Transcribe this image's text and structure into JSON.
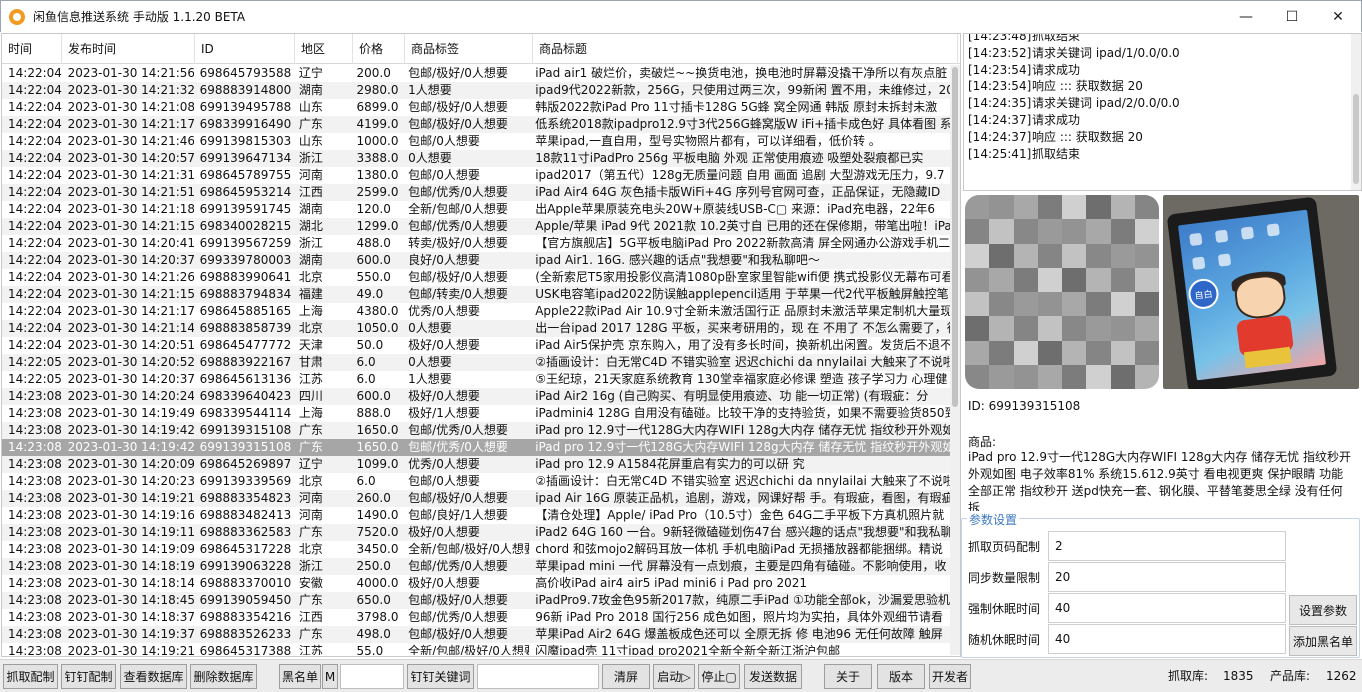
{
  "window": {
    "title": "闲鱼信息推送系统 手动版 1.1.20 BETA",
    "controls": [
      "—",
      "☐",
      "✕"
    ]
  },
  "table": {
    "headers": [
      "时间",
      "发布时间",
      "ID",
      "地区",
      "价格",
      "商品标签",
      "商品标题"
    ],
    "selected_index": 22,
    "rows": [
      [
        "14:22:04",
        "2023-01-30 14:21:56",
        "698645793588",
        "辽宁",
        "200.0",
        "包邮/极好/0人想要",
        "iPad air1 破烂价，卖破烂~~换货电池，换电池时屏幕没撬干净所以有灰点脏"
      ],
      [
        "14:22:04",
        "2023-01-30 14:21:32",
        "698883914800",
        "湖南",
        "2980.0",
        "1人想要",
        "ipad9代2022新款，256G，只使用过两三次，99新闲 置不用，未维修过，2023"
      ],
      [
        "14:22:04",
        "2023-01-30 14:21:08",
        "699139495788",
        "山东",
        "6899.0",
        "包邮/极好/0人想要",
        "韩版2022款iPad Pro 11寸插卡128G  5G蜂 窝全网通 韩版    原封未拆封未激"
      ],
      [
        "14:22:04",
        "2023-01-30 14:21:17",
        "698339916490",
        "广东",
        "4199.0",
        "包邮/极好/0人想要",
        "低系统2018款ipadpro12.9寸3代256G蜂窝版W iFi+插卡成色好 具体看图 系"
      ],
      [
        "14:22:04",
        "2023-01-30 14:21:46",
        "699139815303",
        "山东",
        "1000.0",
        "包邮/0人想要",
        "苹果ipad,一直自用，型号实物照片都有，可以详细看，低价转 。"
      ],
      [
        "14:22:04",
        "2023-01-30 14:20:57",
        "699139647134",
        "浙江",
        "3388.0",
        "0人想要",
        "18款11寸iPadPro   256g  平板电脑  外观 正常使用痕迹   吸塑处裂痕都已实"
      ],
      [
        "14:22:04",
        "2023-01-30 14:21:31",
        "698645789755",
        "河南",
        "1380.0",
        "包邮/0人想要",
        "ipad2017（第五代）128g无质量问题   自用 画面 追剧 大型游戏无压力，9.7"
      ],
      [
        "14:22:04",
        "2023-01-30 14:21:51",
        "698645953214",
        "江西",
        "2599.0",
        "包邮/优秀/0人想要",
        "iPad Air4  64G 灰色插卡版WiFi+4G 序列号官网可查，正品保证，无隐藏ID"
      ],
      [
        "14:22:04",
        "2023-01-30 14:21:18",
        "699139591745",
        "湖南",
        "120.0",
        "全新/包邮/0人想要",
        "出Apple苹果原装充电头20W+原装线USB-C▢   来源：iPad充电器，22年6"
      ],
      [
        "14:22:04",
        "2023-01-30 14:21:15",
        "698340028215",
        "湖北",
        "1299.0",
        "包邮/优秀/0人想要",
        "Apple/苹果 iPad 9代 2021款 10.2英寸自 已用的还在保修期，带笔出啦！iPa"
      ],
      [
        "14:22:04",
        "2023-01-30 14:20:41",
        "699139567259",
        "浙江",
        "488.0",
        "转卖/极好/0人想要",
        "【官方旗舰店】5G平板电脑iPad Pro 2022新款高清 屏全网通办公游戏手机二"
      ],
      [
        "14:22:04",
        "2023-01-30 14:20:37",
        "699339780003",
        "湖南",
        "600.0",
        "良好/0人想要",
        "ipad Air1. 16G. 感兴趣的话点\"我想要\"和我私聊吧～"
      ],
      [
        "14:22:04",
        "2023-01-30 14:21:26",
        "698883990641",
        "北京",
        "550.0",
        "包邮/极好/0人想要",
        "(全新索尼T5家用投影仪高清1080p卧室家里智能wifi便 携式投影仪无幕布可看"
      ],
      [
        "14:22:04",
        "2023-01-30 14:21:15",
        "698883794834",
        "福建",
        "49.0",
        "包邮/转卖/0人想要",
        "USK电容笔ipad2022防误触applepencil适用 于苹果一代2代平板触屏触控笔"
      ],
      [
        "14:22:04",
        "2023-01-30 14:21:17",
        "698645885165",
        "上海",
        "4380.0",
        "优秀/0人想要",
        "Apple22款iPad Air 10.9寸全新未激活国行正 品原封未激活苹果定制机大量现"
      ],
      [
        "14:22:04",
        "2023-01-30 14:21:14",
        "698883858739",
        "北京",
        "1050.0",
        "0人想要",
        "出一台ipad 2017 128G 平板，买来考研用的，现 在 不用了 不怎么需要了，很"
      ],
      [
        "14:22:04",
        "2023-01-30 14:20:51",
        "698645477772",
        "天津",
        "50.0",
        "极好/0人想要",
        "iPad Air5保护壳 京东购入，用了没有多长时间，换新机出闲置。发货后不退不"
      ],
      [
        "14:22:05",
        "2023-01-30 14:20:52",
        "698883922167",
        "甘肃",
        "6.0",
        "0人想要",
        "②插画设计：白无常C4D 不错实验室 迟迟chichi da nnylailai 大触来了不说啦"
      ],
      [
        "14:22:05",
        "2023-01-30 14:20:37",
        "698645613136",
        "江苏",
        "6.0",
        "1人想要",
        "⑤王纪琼，21天家庭系统教育 130堂幸福家庭必修课  塑造 孩子学习力 心理健"
      ],
      [
        "14:23:08",
        "2023-01-30 14:20:24",
        "698339640423",
        "四川",
        "600.0",
        "极好/0人想要",
        "iPad Air2 16g   (自己购买、有明显使用痕迹、功 能一切正常)   (有瑕疵：分"
      ],
      [
        "14:23:08",
        "2023-01-30 14:19:49",
        "698339544114",
        "上海",
        "888.0",
        "极好/1人想要",
        "iPadmini4 128G 自用没有磕碰。比较干净的支持验货，如果不需要验货850到"
      ],
      [
        "14:23:08",
        "2023-01-30 14:19:42",
        "699139315108",
        "广东",
        "1650.0",
        "包邮/优秀/0人想要",
        "iPad pro 12.9寸一代128G大内存WIFI 128g大内存 储存无忧 指纹秒开外观如"
      ],
      [
        "14:23:08",
        "2023-01-30 14:19:42",
        "699139315108",
        "广东",
        "1650.0",
        "包邮/优秀/0人想要",
        "iPad pro 12.9寸一代128G大内存WIFI 128g大内存 储存无忧 指纹秒开外观如"
      ],
      [
        "14:23:08",
        "2023-01-30 14:20:09",
        "698645269897",
        "辽宁",
        "1099.0",
        "优秀/0人想要",
        "iPad pro 12.9 A1584花屏重启有实力的可以研 究"
      ],
      [
        "14:23:08",
        "2023-01-30 14:20:23",
        "699139339569",
        "北京",
        "6.0",
        "包邮/0人想要",
        "②插画设计：白无常C4D 不错实验室 迟迟chichi da nnylailai 大触来了不说啦"
      ],
      [
        "14:23:08",
        "2023-01-30 14:19:21",
        "698883354823",
        "河南",
        "260.0",
        "包邮/极好/0人想要",
        "ipad Air 16G 原装正品机，追剧，游戏，网课好帮 手。有瑕疵，看图，有瑕疵"
      ],
      [
        "14:23:08",
        "2023-01-30 14:19:16",
        "698883482413",
        "河南",
        "1490.0",
        "包邮/良好/1人想要",
        "【清仓处理】Apple/ iPad Pro（10.5寸）金色 64G二手平板下方真机照片就"
      ],
      [
        "14:23:08",
        "2023-01-30 14:19:11",
        "698883362583",
        "广东",
        "7520.0",
        "极好/0人想要",
        "iPad2 64G 160 一台。9新轻微磕碰划伤47台 感兴趣的话点\"我想要\"和我私聊"
      ],
      [
        "14:23:08",
        "2023-01-30 14:19:09",
        "698645317228",
        "北京",
        "3450.0",
        "全新/包邮/极好/0人想要",
        "chord 和弦mojo2解码耳放一体机 手机电脑iPad 无损播放器都能捆绑。精说"
      ],
      [
        "14:23:08",
        "2023-01-30 14:18:19",
        "699139063228",
        "浙江",
        "250.0",
        "包邮/优秀/0人想要",
        "苹果ipad mini 一代 屏幕没有一点划痕，主要是四角有磕碰。不影响使用，收"
      ],
      [
        "14:23:08",
        "2023-01-30 14:18:14",
        "698883370010",
        "安徽",
        "4000.0",
        "极好/0人想要",
        "高价收iPad air4 air5 iPad mini6 i Pad pro 2021"
      ],
      [
        "14:23:08",
        "2023-01-30 14:18:45",
        "699139059450",
        "广东",
        "650.0",
        "包邮/极好/0人想要",
        "iPadPro9.7玫金色95新2017款，纯原二手iPad ①功能全部ok，沙漏爱思验机"
      ],
      [
        "14:23:08",
        "2023-01-30 14:18:37",
        "698883354216",
        "江西",
        "3798.0",
        "包邮/优秀/0人想要",
        "96新  iPad Pro 2018  国行256 成色如图，照片均为实拍，具体外观细节请看"
      ],
      [
        "14:23:08",
        "2023-01-30 14:19:37",
        "698883526233",
        "广东",
        "498.0",
        "包邮/极好/0人想要",
        "苹果iPad Air2 64G 爆盖板成色还可以  全原无拆 修 电池96 无任何故障  触屏"
      ],
      [
        "14:23:08",
        "2023-01-30 14:19:21",
        "698645317388",
        "江苏",
        "55.0",
        "全新/包邮/极好/0人想要",
        "闪魔ipad壳 11寸ipad pro2021全新全新全新江浙沪包邮"
      ]
    ]
  },
  "log": [
    [
      "[14:23:48]",
      "抓取结束"
    ],
    [
      "[14:23:52]",
      "请求关键词 ipad/1/0.0/0.0"
    ],
    [
      "[14:23:54]",
      "请求成功"
    ],
    [
      "[14:23:54]",
      "响应 ::: 获取数据 20"
    ],
    [
      "[14:24:35]",
      "请求关键词 ipad/2/0.0/0.0"
    ],
    [
      "[14:24:37]",
      "请求成功"
    ],
    [
      "[14:24:37]",
      "响应 ::: 获取数据 20"
    ],
    [
      "[14:25:41]",
      "抓取结束"
    ]
  ],
  "detail": {
    "id_text": "ID: 699139315108",
    "goods_label": "商品:",
    "goods_text": "iPad pro 12.9寸一代128G大内存WIFI 128g大内存 储存无忧 指纹秒开外观如图 电子效率81% 系统15.612.9英寸 看电视更爽 保护眼睛  功能全部正常  指纹秒开 送pd快充一套、钢化膜、平替笔菱思全绿  没有任何拆",
    "tablet_badge": "自白"
  },
  "params": {
    "legend": "参数设置",
    "fields": [
      {
        "label": "抓取页码配制",
        "value": "2"
      },
      {
        "label": "同步数量限制",
        "value": "20"
      },
      {
        "label": "强制休眠时间",
        "value": "40"
      },
      {
        "label": "随机休眠时间",
        "value": "40"
      }
    ],
    "set_button": "设置参数",
    "blacklist_button": "添加黑名单"
  },
  "toolbar": {
    "grab_config": "抓取配制",
    "dingding_config": "钉钉配制",
    "view_db": "查看数据库",
    "delete_db": "删除数据库",
    "blacklist": "黑名单",
    "m_label": "M",
    "dingding_keyword": "钉钉关键词",
    "clear": "清屏",
    "start": "启动▷",
    "stop": "停止▢",
    "send_data": "发送数据",
    "about": "关于",
    "version": "版本",
    "developer": "开发者",
    "grab_count_label": "抓取库:",
    "grab_count": "1835",
    "product_count_label": "产品库:",
    "product_count": "1262"
  }
}
